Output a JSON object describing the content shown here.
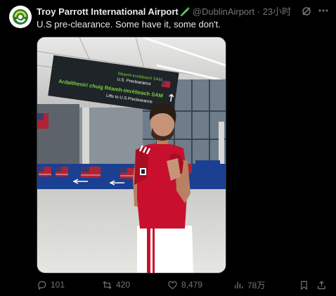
{
  "post": {
    "display_name": "Troy Parrott International Airport",
    "name_emoji": "shamrock-flag-icon",
    "handle": "@DublinAirport",
    "separator": "·",
    "time": "23小时",
    "text": "U.S pre-clearance. Some have it, some don't."
  },
  "media": {
    "sign_lines": [
      "Réamh-imréiteach SAM",
      "U.S. Preclearance",
      "Ardaitheoirí chuig Réamh-imréiteach SAM",
      "Lifts to U.S.Preclearance"
    ]
  },
  "actions": {
    "replies": "101",
    "reposts": "420",
    "likes": "8,479",
    "views": "78万"
  },
  "colors": {
    "background": "#000000",
    "text": "#e7e9ea",
    "muted": "#71767b",
    "sign_green": "#7bd23f"
  }
}
